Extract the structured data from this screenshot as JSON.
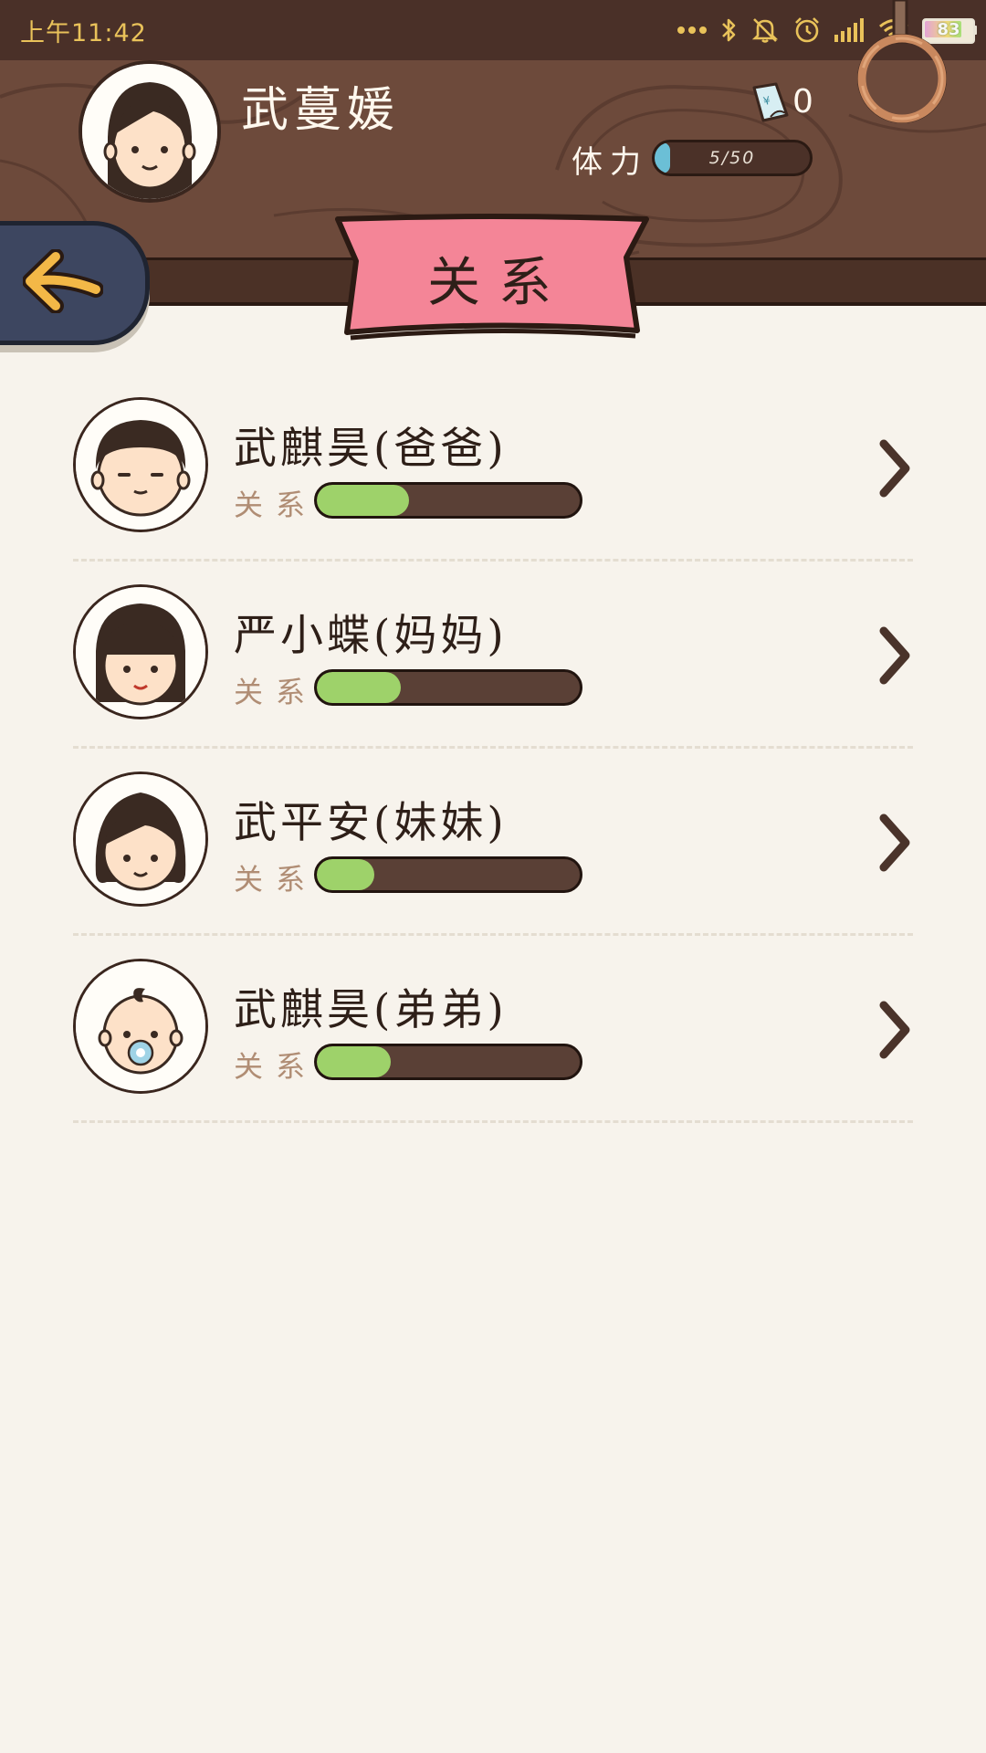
{
  "status_bar": {
    "time": "上午11:42",
    "battery": "83",
    "battery_level": 0.83
  },
  "player": {
    "name": "武蔓媛",
    "coupon_count": "0",
    "stamina_label": "体力",
    "stamina_text": "5/50",
    "stamina_level": 0.1
  },
  "page": {
    "title": "关系"
  },
  "relations": [
    {
      "name": "武麒昊(爸爸)",
      "label": "关系",
      "level": 0.35,
      "avatar": "father-avatar"
    },
    {
      "name": "严小蝶(妈妈)",
      "label": "关系",
      "level": 0.32,
      "avatar": "mother-avatar"
    },
    {
      "name": "武平安(妹妹)",
      "label": "关系",
      "level": 0.22,
      "avatar": "sister-avatar"
    },
    {
      "name": "武麒昊(弟弟)",
      "label": "关系",
      "level": 0.28,
      "avatar": "baby-brother-avatar"
    }
  ],
  "colors": {
    "header_wood": "#6d4a3b",
    "banner": "#f48597",
    "bar_fill": "#9ed26a",
    "stamina_fill": "#6bbfd6",
    "back_button": "#3d4660",
    "arrow": "#f3b847"
  }
}
